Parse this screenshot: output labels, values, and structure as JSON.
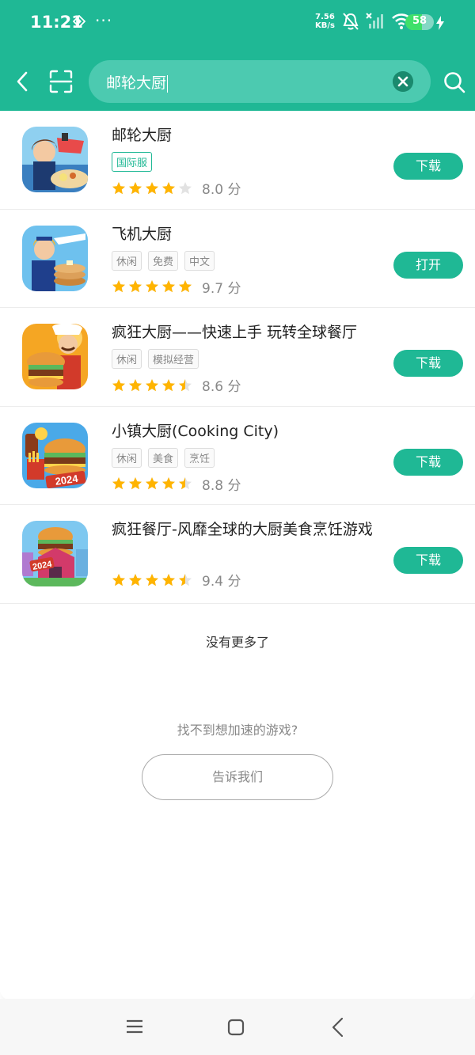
{
  "status_bar": {
    "time": "11:21",
    "net_speed_value": "7.56",
    "net_speed_unit": "KB/s",
    "battery": "58",
    "battery_level": 0.58
  },
  "search": {
    "query": "邮轮大厨"
  },
  "apps": [
    {
      "name": "邮轮大厨",
      "tags": [
        "国际服"
      ],
      "rating": 4,
      "score": "8.0 分",
      "action": "下载"
    },
    {
      "name": "飞机大厨",
      "tags": [
        "休闲",
        "免费",
        "中文"
      ],
      "rating": 5,
      "score": "9.7 分",
      "action": "打开"
    },
    {
      "name": "疯狂大厨——快速上手 玩转全球餐厅",
      "tags": [
        "休闲",
        "模拟经营"
      ],
      "rating": 4.5,
      "score": "8.6 分",
      "action": "下载"
    },
    {
      "name": "小镇大厨(Cooking City)",
      "tags": [
        "休闲",
        "美食",
        "烹饪"
      ],
      "rating": 4.5,
      "score": "8.8 分",
      "action": "下载"
    },
    {
      "name": "疯狂餐厅-风靡全球的大厨美食烹饪游戏",
      "tags": [],
      "rating": 4.5,
      "score": "9.4 分",
      "action": "下载"
    }
  ],
  "icon_texts": {
    "app4": "2024",
    "app5": "2024"
  },
  "footer": {
    "no_more": "没有更多了",
    "cant_find": "找不到想加速的游戏?",
    "tell_us": "告诉我们"
  },
  "colors": {
    "primary": "#1fb895",
    "star": "#ffb400"
  }
}
